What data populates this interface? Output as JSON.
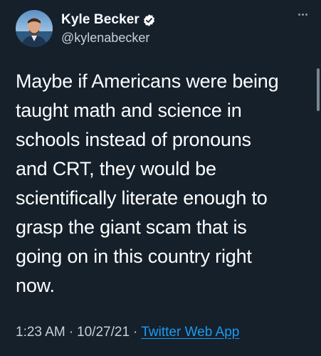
{
  "author": {
    "display_name": "Kyle Becker",
    "handle": "@kylenabecker",
    "verified": true
  },
  "tweet": {
    "text": "Maybe if Americans were being\ntaught math and science in\nschools instead of pronouns\nand CRT, they would be\nscientifically literate enough to\ngrasp the giant scam that is\ngoing on in this country right\nnow.",
    "time": "1:23 AM",
    "date": "10/27/21",
    "separator": "·",
    "source": "Twitter Web App"
  },
  "icons": {
    "verified": "verified-badge-icon",
    "more": "more-options-icon"
  },
  "colors": {
    "background": "#15202b",
    "text": "#ffffff",
    "secondary_text": "#c8d0d8",
    "link": "#1d9bf0",
    "verified": "#1d9bf0"
  }
}
